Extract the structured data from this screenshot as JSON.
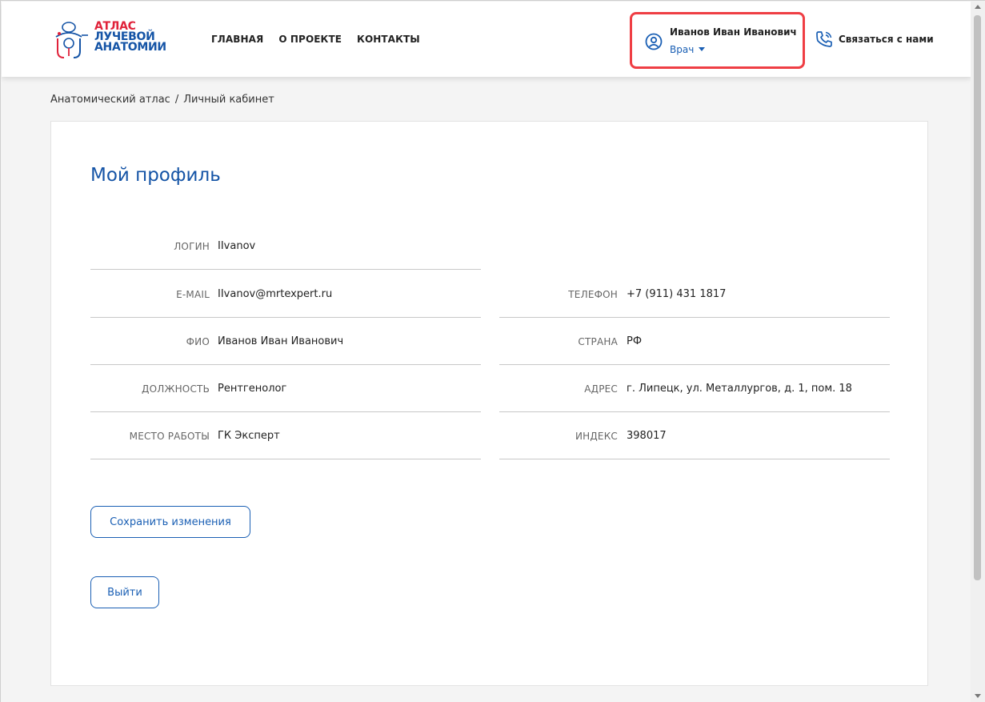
{
  "header": {
    "logo": {
      "line1": "АТЛАС",
      "line2": "ЛУЧЕВОЙ",
      "line3": "АНАТОМИИ"
    },
    "nav": [
      "ГЛАВНАЯ",
      "О ПРОЕКТЕ",
      "КОНТАКТЫ"
    ],
    "user": {
      "name": "Иванов Иван Иванович",
      "role": "Врач",
      "icon": "user-circle-icon"
    },
    "contact": {
      "label": "Связаться с нами",
      "icon": "phone-call-icon"
    }
  },
  "breadcrumb": {
    "items": [
      "Анатомический атлас",
      "Личный кабинет"
    ],
    "separator": "/"
  },
  "profile": {
    "title": "Мой профиль",
    "fields": {
      "login": {
        "label": "ЛОГИН",
        "value": "IIvanov"
      },
      "email": {
        "label": "E-MAIL",
        "value": "IIvanov@mrtexpert.ru"
      },
      "fio": {
        "label": "ФИО",
        "value": "Иванов Иван Иванович"
      },
      "position": {
        "label": "ДОЛЖНОСТЬ",
        "value": "Рентгенолог"
      },
      "workplace": {
        "label": "МЕСТО РАБОТЫ",
        "value": "ГК Эксперт"
      },
      "phone": {
        "label": "ТЕЛЕФОН",
        "value": "+7 (911) 431 1817"
      },
      "country": {
        "label": "СТРАНА",
        "value": "РФ"
      },
      "address": {
        "label": "АДРЕС",
        "value": "г. Липецк, ул. Металлургов, д. 1, пом. 18"
      },
      "index": {
        "label": "ИНДЕКС",
        "value": "398017"
      }
    },
    "save_label": "Сохранить изменения",
    "logout_label": "Выйти"
  },
  "colors": {
    "brand_blue": "#1554a6",
    "brand_red": "#e0223a",
    "highlight": "#ef3e44"
  }
}
